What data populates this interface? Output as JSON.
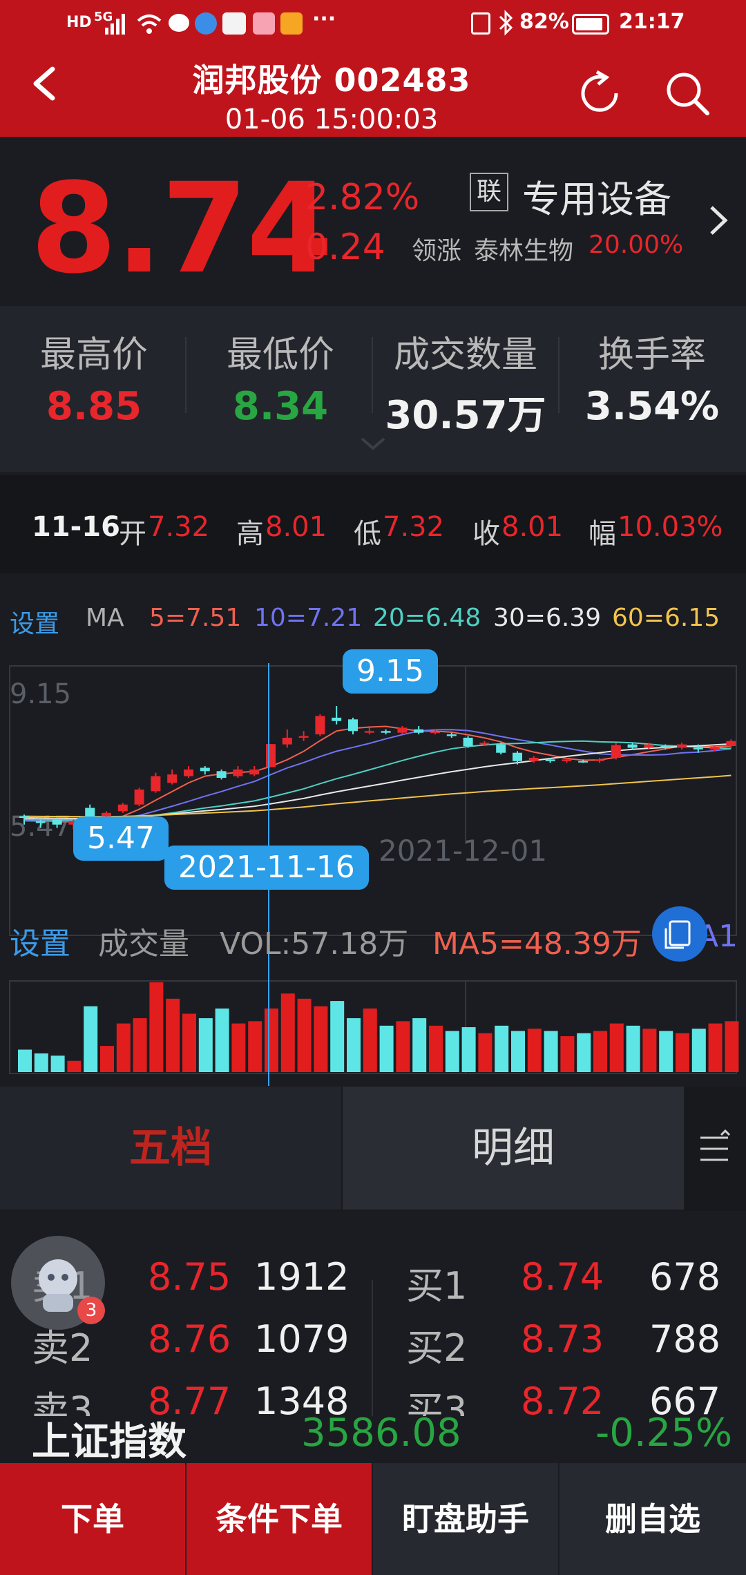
{
  "status_bar": {
    "network": "HD",
    "signal": "5G",
    "battery": "82%",
    "time": "21:17",
    "more": "···"
  },
  "header": {
    "title": "润邦股份 002483",
    "subtitle": "01-06 15:00:03"
  },
  "quote": {
    "price": "8.74",
    "change_pct": "2.82%",
    "change": "0.24",
    "sector_badge": "联",
    "sector": "专用设备",
    "leader_label": "领涨",
    "leader_name": "泰林生物",
    "leader_pct": "20.00%"
  },
  "stats": [
    {
      "label": "最高价",
      "value": "8.85"
    },
    {
      "label": "最低价",
      "value": "8.34"
    },
    {
      "label": "成交数量",
      "value": "30.57万"
    },
    {
      "label": "换手率",
      "value": "3.54%"
    }
  ],
  "day_info": {
    "date": "11-16",
    "open_label": "开",
    "open": "7.32",
    "high_label": "高",
    "high": "8.01",
    "low_label": "低",
    "low": "7.32",
    "close_label": "收",
    "close": "8.01",
    "range_label": "幅",
    "range": "10.03%"
  },
  "ma_legend": {
    "settings": "设置",
    "ma": "MA",
    "ma5": "5=7.51",
    "ma10": "10=7.21",
    "ma20": "20=6.48",
    "ma30": "30=6.39",
    "ma60": "60=6.15"
  },
  "chart_labels": {
    "axis_high": "9.15",
    "axis_low": "5.47",
    "high_tag": "9.15",
    "low_tag": "5.47",
    "cursor_date": "2021-11-16",
    "mid_date": "2021-12-01"
  },
  "volume_legend": {
    "settings": "设置",
    "name": "成交量",
    "vol": "VOL:57.18万",
    "ma5": "MA5=48.39万",
    "ma10_partial": "A1"
  },
  "tabs": {
    "five_level": "五档",
    "detail": "明细"
  },
  "order_book": {
    "sell": [
      {
        "label": "卖1",
        "price": "8.75",
        "volume": "1912"
      },
      {
        "label": "卖2",
        "price": "8.76",
        "volume": "1079"
      },
      {
        "label": "卖3",
        "price": "8.77",
        "volume": "1348"
      }
    ],
    "buy": [
      {
        "label": "买1",
        "price": "8.74",
        "volume": "678"
      },
      {
        "label": "买2",
        "price": "8.73",
        "volume": "788"
      },
      {
        "label": "买3",
        "price": "8.72",
        "volume": "667"
      }
    ],
    "avatar_badge": "3"
  },
  "index_strip": {
    "name": "上证指数",
    "value": "3586.08",
    "change": "-0.25%"
  },
  "actions": {
    "order": "下单",
    "conditional": "条件下单",
    "assistant": "盯盘助手",
    "remove": "删自选"
  },
  "colors": {
    "up": "#e8262b",
    "down": "#27a642",
    "header_bg": "#c0141c",
    "candle_down": "#5ee6e6",
    "ma5": "#f0604f",
    "ma10": "#6f73f2",
    "ma20": "#4fd0c4",
    "ma30": "#e9e9e9",
    "ma60": "#f2c44c"
  },
  "chart_data": {
    "type": "candlestick",
    "price_range": [
      5.47,
      9.15
    ],
    "candles": [
      {
        "o": 5.85,
        "c": 5.8,
        "h": 5.9,
        "l": 5.6
      },
      {
        "o": 5.7,
        "c": 5.65,
        "h": 5.75,
        "l": 5.5
      },
      {
        "o": 5.75,
        "c": 5.6,
        "h": 5.8,
        "l": 5.5
      },
      {
        "o": 5.6,
        "c": 5.7,
        "h": 5.75,
        "l": 5.47
      },
      {
        "o": 6.1,
        "c": 5.8,
        "h": 6.2,
        "l": 5.75
      },
      {
        "o": 5.85,
        "c": 5.95,
        "h": 6.0,
        "l": 5.8
      },
      {
        "o": 6.0,
        "c": 6.2,
        "h": 6.25,
        "l": 5.95
      },
      {
        "o": 6.2,
        "c": 6.65,
        "h": 6.7,
        "l": 6.15
      },
      {
        "o": 6.6,
        "c": 7.05,
        "h": 7.15,
        "l": 6.55
      },
      {
        "o": 6.85,
        "c": 7.1,
        "h": 7.25,
        "l": 6.8
      },
      {
        "o": 7.05,
        "c": 7.25,
        "h": 7.35,
        "l": 7.0
      },
      {
        "o": 7.3,
        "c": 7.2,
        "h": 7.35,
        "l": 7.1
      },
      {
        "o": 7.2,
        "c": 7.0,
        "h": 7.25,
        "l": 6.95
      },
      {
        "o": 7.05,
        "c": 7.25,
        "h": 7.35,
        "l": 7.0
      },
      {
        "o": 7.1,
        "c": 7.25,
        "h": 7.35,
        "l": 7.05
      },
      {
        "o": 7.32,
        "c": 8.01,
        "h": 8.01,
        "l": 7.32
      },
      {
        "o": 8.0,
        "c": 8.2,
        "h": 8.45,
        "l": 7.9
      },
      {
        "o": 8.2,
        "c": 8.25,
        "h": 8.4,
        "l": 8.1
      },
      {
        "o": 8.3,
        "c": 8.85,
        "h": 8.9,
        "l": 8.25
      },
      {
        "o": 8.8,
        "c": 8.7,
        "h": 9.15,
        "l": 8.6
      },
      {
        "o": 8.75,
        "c": 8.4,
        "h": 8.8,
        "l": 8.3
      },
      {
        "o": 8.35,
        "c": 8.4,
        "h": 8.5,
        "l": 8.3
      },
      {
        "o": 8.4,
        "c": 8.35,
        "h": 8.45,
        "l": 8.3
      },
      {
        "o": 8.35,
        "c": 8.5,
        "h": 8.55,
        "l": 8.3
      },
      {
        "o": 8.45,
        "c": 8.35,
        "h": 8.55,
        "l": 8.3
      },
      {
        "o": 8.35,
        "c": 8.38,
        "h": 8.45,
        "l": 8.3
      },
      {
        "o": 8.3,
        "c": 8.25,
        "h": 8.35,
        "l": 8.2
      },
      {
        "o": 8.2,
        "c": 7.95,
        "h": 8.25,
        "l": 7.9
      },
      {
        "o": 8.0,
        "c": 8.05,
        "h": 8.1,
        "l": 7.95
      },
      {
        "o": 8.0,
        "c": 7.75,
        "h": 8.05,
        "l": 7.7
      },
      {
        "o": 7.75,
        "c": 7.5,
        "h": 7.8,
        "l": 7.4
      },
      {
        "o": 7.5,
        "c": 7.6,
        "h": 7.65,
        "l": 7.45
      },
      {
        "o": 7.55,
        "c": 7.5,
        "h": 7.6,
        "l": 7.45
      },
      {
        "o": 7.5,
        "c": 7.55,
        "h": 7.6,
        "l": 7.45
      },
      {
        "o": 7.5,
        "c": 7.48,
        "h": 7.55,
        "l": 7.45
      },
      {
        "o": 7.5,
        "c": 7.55,
        "h": 7.6,
        "l": 7.45
      },
      {
        "o": 7.6,
        "c": 7.98,
        "h": 8.05,
        "l": 7.55
      },
      {
        "o": 8.0,
        "c": 7.9,
        "h": 8.05,
        "l": 7.85
      },
      {
        "o": 7.9,
        "c": 8.0,
        "h": 8.05,
        "l": 7.85
      },
      {
        "o": 7.95,
        "c": 7.9,
        "h": 8.0,
        "l": 7.85
      },
      {
        "o": 7.9,
        "c": 8.0,
        "h": 8.05,
        "l": 7.85
      },
      {
        "o": 7.9,
        "c": 7.85,
        "h": 8.0,
        "l": 7.75
      },
      {
        "o": 7.85,
        "c": 7.92,
        "h": 7.95,
        "l": 7.8
      },
      {
        "o": 7.95,
        "c": 8.1,
        "h": 8.15,
        "l": 7.9
      }
    ],
    "volume": [
      30,
      25,
      22,
      15,
      88,
      35,
      65,
      72,
      120,
      98,
      78,
      72,
      85,
      65,
      68,
      85,
      105,
      98,
      88,
      95,
      72,
      85,
      62,
      68,
      72,
      62,
      55,
      60,
      52,
      62,
      55,
      58,
      55,
      48,
      52,
      55,
      65,
      62,
      58,
      55,
      52,
      58,
      65,
      68
    ],
    "volume_max": 120
  }
}
